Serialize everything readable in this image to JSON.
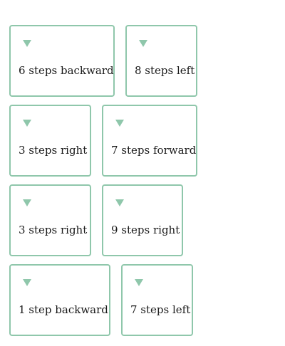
{
  "cards": [
    {
      "label": "6 steps backward"
    },
    {
      "label": "8 steps left"
    },
    {
      "label": "3 steps right"
    },
    {
      "label": "7 steps forward"
    },
    {
      "label": "3 steps right"
    },
    {
      "label": "9 steps right"
    },
    {
      "label": "1 step backward"
    },
    {
      "label": "7 steps left"
    }
  ],
  "colors": {
    "accent": "#8fc7ab",
    "text": "#1a1a1a",
    "background": "#ffffff"
  },
  "icons": {
    "card_marker": "triangle-down-icon"
  }
}
